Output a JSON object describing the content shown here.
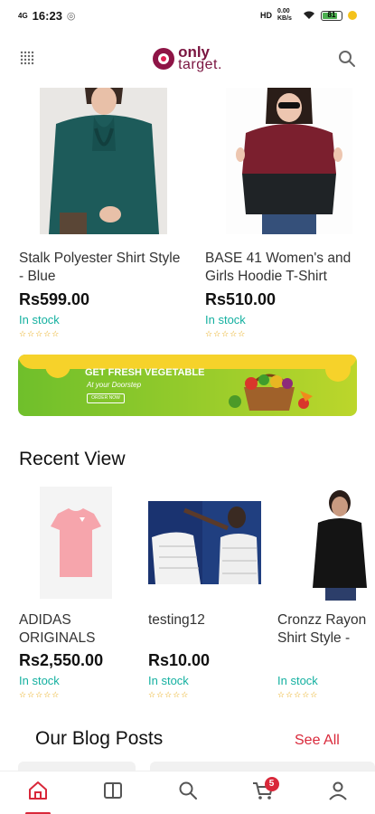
{
  "status_bar": {
    "time": "16:23",
    "speed": "0.00 KB/s",
    "battery": "81"
  },
  "brand": {
    "line1": "only",
    "line2": "target."
  },
  "products": [
    {
      "name": "Stalk Polyester Shirt Style - Blue",
      "price": "Rs599.00",
      "stock": "In stock"
    },
    {
      "name": "BASE 41 Women's and Girls Hoodie T-Shirt",
      "price": "Rs510.00",
      "stock": "In stock"
    }
  ],
  "banner": {
    "title": "GET FRESH VEGETABLE",
    "subtitle": "At your Doorstep",
    "button": "ORDER NOW"
  },
  "recent_view": {
    "title": "Recent View",
    "items": [
      {
        "name": "ADIDAS ORIGINALS",
        "price": "Rs2,550.00",
        "stock": "In stock"
      },
      {
        "name": "testing12",
        "price": "Rs10.00",
        "stock": "In stock"
      },
      {
        "name": "Cronzz Rayon Shirt Style -",
        "price": "",
        "stock": "In stock"
      }
    ]
  },
  "blog": {
    "title": "Our Blog Posts",
    "see_all": "See All"
  },
  "nav": {
    "cart_count": "5"
  },
  "colors": {
    "accent": "#d9283a",
    "stock": "#14b0a0",
    "brand": "#7a1540"
  }
}
